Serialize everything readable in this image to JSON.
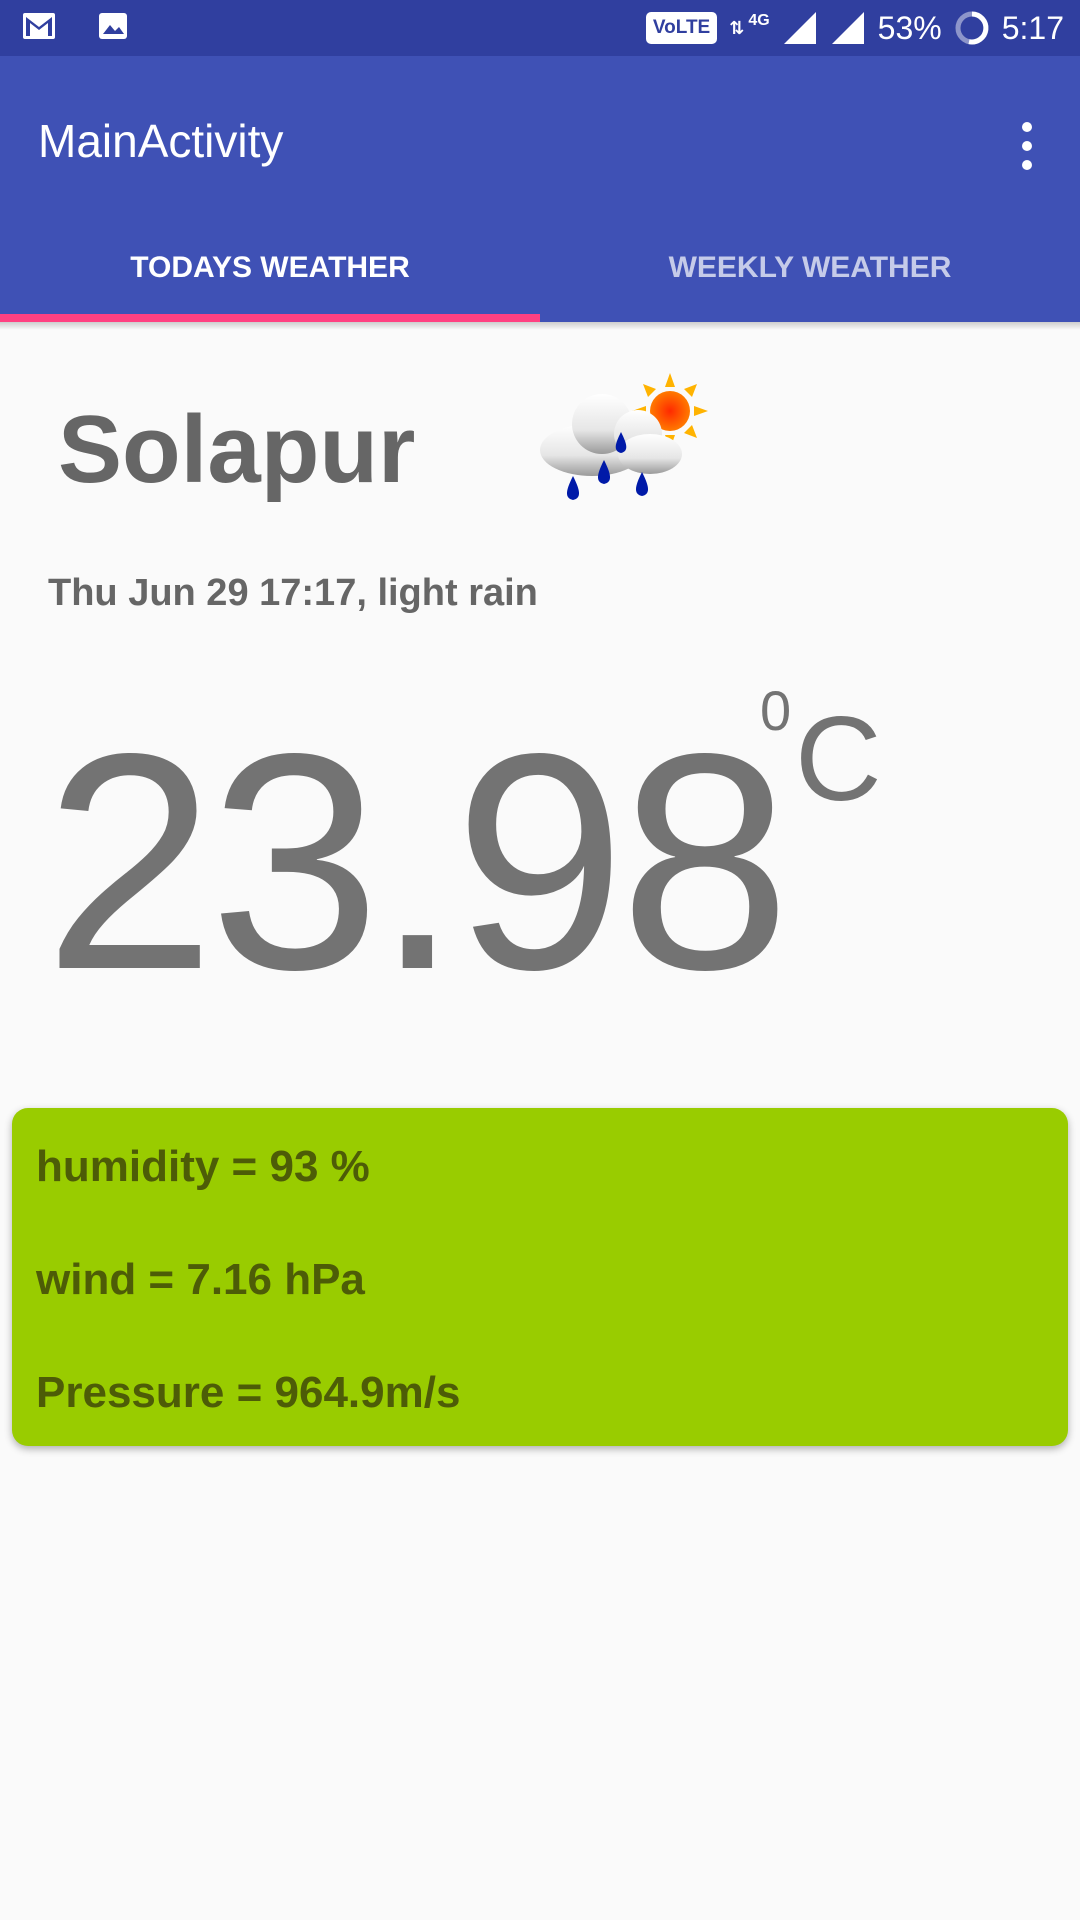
{
  "status_bar": {
    "volte": "VoLTE",
    "network": "4G",
    "battery": "53%",
    "time": "5:17",
    "icons": [
      "gmail-icon",
      "image-icon",
      "data-arrows-icon",
      "signal-icon",
      "signal-icon",
      "battery-icon"
    ]
  },
  "app_bar": {
    "title": "MainActivity",
    "tabs": [
      {
        "label": "TODAYS WEATHER",
        "selected": true
      },
      {
        "label": "WEEKLY WEATHER",
        "selected": false
      }
    ],
    "colors": {
      "primary": "#3f51b5",
      "primary_dark": "#303f9f",
      "accent": "#ff4081"
    }
  },
  "weather": {
    "city": "Solapur",
    "condition_icon": "rain-sun-icon",
    "description": "Thu Jun 29 17:17, light rain",
    "temperature": "23.98",
    "degree": "0",
    "unit": "C"
  },
  "details": {
    "humidity": "humidity = 93 %",
    "wind": "wind = 7.16 hPa",
    "pressure": "Pressure = 964.9m/s",
    "card_color": "#99cc00"
  }
}
